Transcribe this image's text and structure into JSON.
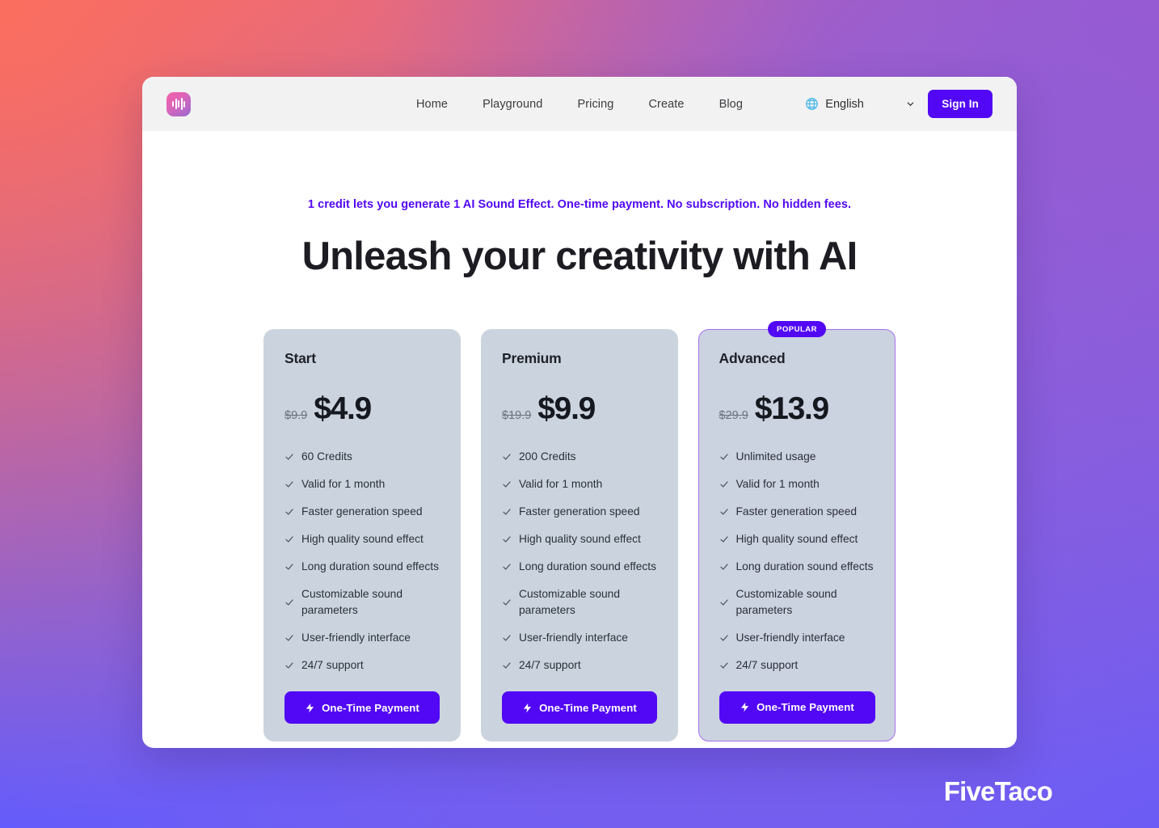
{
  "navbar": {
    "logo_icon": "waveform-logo-icon",
    "links": [
      {
        "label": "Home"
      },
      {
        "label": "Playground"
      },
      {
        "label": "Pricing"
      },
      {
        "label": "Create"
      },
      {
        "label": "Blog"
      }
    ],
    "language": {
      "icon": "globe-icon",
      "selected": "English",
      "options": [
        "English"
      ]
    },
    "signin_label": "Sign In"
  },
  "hero": {
    "subtitle": "1 credit lets you generate 1 AI Sound Effect. One-time payment. No subscription. No hidden fees.",
    "title": "Unleash your creativity with AI"
  },
  "pricing": {
    "plans": [
      {
        "name": "Start",
        "price_old": "$9.9",
        "price_new": "$4.9",
        "badge": "",
        "featured": false,
        "features": [
          "60 Credits",
          "Valid for 1 month",
          "Faster generation speed",
          "High quality sound effect",
          "Long duration sound effects",
          "Customizable sound parameters",
          "User-friendly interface",
          "24/7 support"
        ],
        "cta": "One-Time Payment"
      },
      {
        "name": "Premium",
        "price_old": "$19.9",
        "price_new": "$9.9",
        "badge": "",
        "featured": false,
        "features": [
          "200 Credits",
          "Valid for 1 month",
          "Faster generation speed",
          "High quality sound effect",
          "Long duration sound effects",
          "Customizable sound parameters",
          "User-friendly interface",
          "24/7 support"
        ],
        "cta": "One-Time Payment"
      },
      {
        "name": "Advanced",
        "price_old": "$29.9",
        "price_new": "$13.9",
        "badge": "POPULAR",
        "featured": true,
        "features": [
          "Unlimited usage",
          "Valid for 1 month",
          "Faster generation speed",
          "High quality sound effect",
          "Long duration sound effects",
          "Customizable sound parameters",
          "User-friendly interface",
          "24/7 support"
        ],
        "cta": "One-Time Payment"
      }
    ]
  },
  "watermark": {
    "text": "FiveTaco"
  },
  "colors": {
    "accent_purple": "#5208f5",
    "featured_border": "#a971f0",
    "card_bg": "#cbd4de",
    "navbar_bg": "#f2f2f3",
    "heading": "#1c1c22"
  }
}
